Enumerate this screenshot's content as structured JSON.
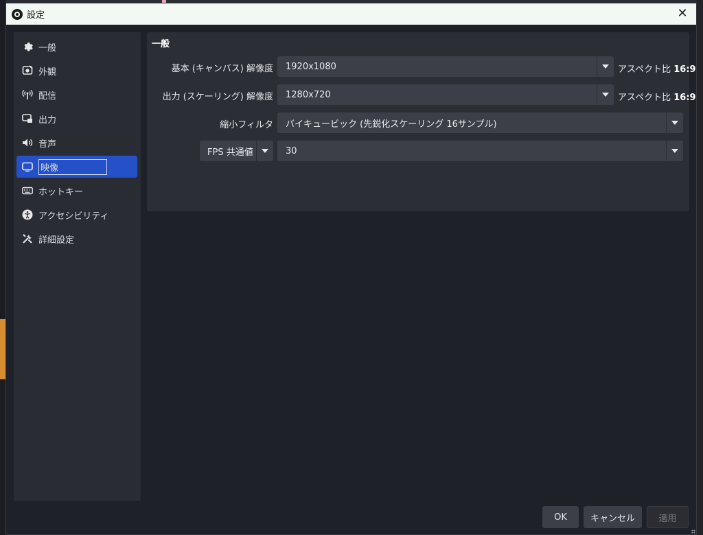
{
  "window": {
    "title": "設定",
    "close_glyph": "✕"
  },
  "sidebar": {
    "items": [
      {
        "label": "一般",
        "icon": "gear-icon"
      },
      {
        "label": "外観",
        "icon": "appearance-icon"
      },
      {
        "label": "配信",
        "icon": "broadcast-icon"
      },
      {
        "label": "出力",
        "icon": "output-icon"
      },
      {
        "label": "音声",
        "icon": "speaker-icon"
      },
      {
        "label": "映像",
        "icon": "monitor-icon",
        "selected": true
      },
      {
        "label": "ホットキー",
        "icon": "keyboard-icon"
      },
      {
        "label": "アクセシビリティ",
        "icon": "accessibility-icon"
      },
      {
        "label": "詳細設定",
        "icon": "tools-icon"
      }
    ]
  },
  "video": {
    "section_title": "一般",
    "base_resolution": {
      "label": "基本 (キャンバス) 解像度",
      "value": "1920x1080",
      "aspect_label": "アスペクト比",
      "aspect_value": "16:9"
    },
    "output_resolution": {
      "label": "出力 (スケーリング) 解像度",
      "value": "1280x720",
      "aspect_label": "アスペクト比",
      "aspect_value": "16:9"
    },
    "downscale_filter": {
      "label": "縮小フィルタ",
      "value": "バイキュービック (先鋭化スケーリング 16サンプル)"
    },
    "fps": {
      "mode": "FPS 共通値",
      "value": "30"
    }
  },
  "buttons": {
    "ok": "OK",
    "cancel": "キャンセル",
    "apply": "適用"
  },
  "colors": {
    "accent": "#2451c7",
    "panel": "#2c2e35",
    "dialog": "#1f2128",
    "titlebar": "#f2f8f3"
  }
}
